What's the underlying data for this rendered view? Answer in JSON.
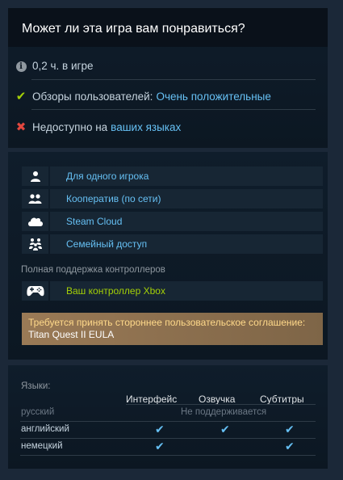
{
  "compat": {
    "title": "Может ли эта игра вам понравиться?",
    "playtime": "0,2 ч. в игре",
    "reviews_label": "Обзоры пользователей:",
    "reviews_value": "Очень положительные",
    "lang_label": "Недоступно на",
    "lang_link": "ваших языках"
  },
  "features": [
    {
      "label": "Для одного игрока",
      "icon": "single-player-icon"
    },
    {
      "label": "Кооператив (по сети)",
      "icon": "coop-icon"
    },
    {
      "label": "Steam Cloud",
      "icon": "cloud-icon"
    },
    {
      "label": "Семейный доступ",
      "icon": "family-icon"
    }
  ],
  "controller": {
    "title": "Полная поддержка контроллеров",
    "item": "Ваш контроллер Xbox",
    "icon": "gamepad-icon"
  },
  "eula": {
    "line1": "Требуется принять стороннее пользовательское соглашение:",
    "line2": "Titan Quest II EULA"
  },
  "languages": {
    "title": "Языки:",
    "headers": [
      "Интерфейс",
      "Озвучка",
      "Субтитры"
    ],
    "rows": [
      {
        "name": "русский",
        "unsupported": "Не поддерживается"
      },
      {
        "name": "английский",
        "checks": [
          "✔",
          "✔",
          "✔"
        ]
      },
      {
        "name": "немецкий",
        "checks": [
          "✔",
          "",
          "✔"
        ]
      }
    ]
  },
  "colors": {
    "background": "#1b2838",
    "link": "#66c0f4",
    "green": "#a4d007",
    "check": "#66c0f4"
  }
}
